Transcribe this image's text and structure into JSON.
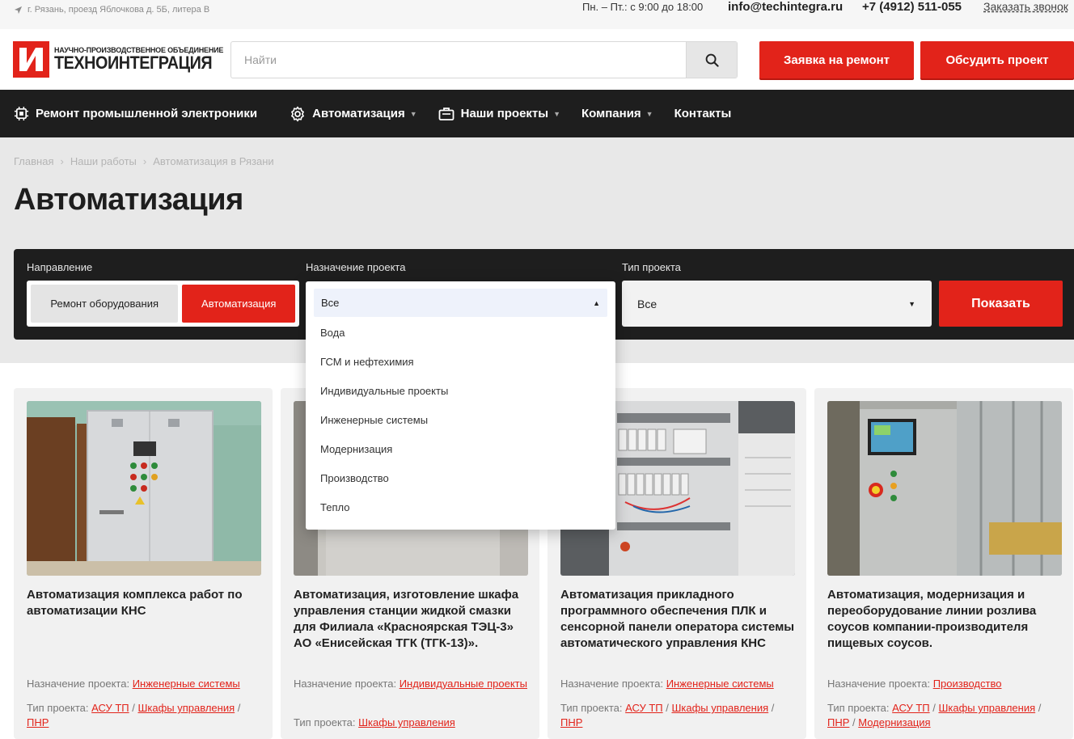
{
  "topbar": {
    "address": "г. Рязань, проезд Яблочкова д. 5Б, литера В",
    "hours": "Пн. – Пт.: с 9:00 до 18:00",
    "email": "info@techintegra.ru",
    "phone": "+7 (4912) 511-055",
    "callback": "Заказать звонок"
  },
  "logo": {
    "subtitle": "НАУЧНО-ПРОИЗВОДСТВЕННОЕ ОБЪЕДИНЕНИЕ",
    "name": "ТЕХНОИНТЕГРАЦИЯ"
  },
  "search": {
    "placeholder": "Найти"
  },
  "header_buttons": {
    "repair": "Заявка на ремонт",
    "discuss": "Обсудить проект"
  },
  "nav": {
    "items": [
      {
        "label": "Ремонт промышленной электроники"
      },
      {
        "label": "Автоматизация"
      },
      {
        "label": "Наши проекты"
      },
      {
        "label": "Компания"
      },
      {
        "label": "Контакты"
      }
    ]
  },
  "breadcrumbs": [
    "Главная",
    "Наши работы",
    "Автоматизация в Рязани"
  ],
  "page_title": "Автоматизация",
  "filters": {
    "direction_label": "Направление",
    "purpose_label": "Назначение проекта",
    "type_label": "Тип проекта",
    "direction_options": [
      "Ремонт оборудования",
      "Автоматизация"
    ],
    "purpose_selected": "Все",
    "purpose_options": [
      "Вода",
      "ГСМ и нефтехимия",
      "Индивидуальные проекты",
      "Инженерные системы",
      "Модернизация",
      "Производство",
      "Тепло"
    ],
    "type_selected": "Все",
    "show_button": "Показать"
  },
  "cards": [
    {
      "title": "Автоматизация комплекса работ по автоматизации КНС",
      "purpose_label": "Назначение проекта:",
      "purpose": "Инженерные системы",
      "type_label": "Тип проекта:",
      "types": [
        "АСУ ТП",
        "Шкафы управления",
        "ПНР"
      ]
    },
    {
      "title": "Автоматизация, изготовление шкафа управления станции жидкой смазки для Филиала «Красноярская ТЭЦ-3» АО «Енисейская ТГК (ТГК-13)».",
      "purpose_label": "Назначение проекта:",
      "purpose": "Индивидуальные проекты",
      "type_label": "Тип проекта:",
      "types": [
        "Шкафы управления"
      ]
    },
    {
      "title": "Автоматизация прикладного программного обеспечения ПЛК и сенсорной панели оператора системы автоматического управления КНС",
      "purpose_label": "Назначение проекта:",
      "purpose": "Инженерные системы",
      "type_label": "Тип проекта:",
      "types": [
        "АСУ ТП",
        "Шкафы управления",
        "ПНР"
      ]
    },
    {
      "title": "Автоматизация, модернизация и переоборудование линии розлива соусов компании-производителя пищевых соусов.",
      "purpose_label": "Назначение проекта:",
      "purpose": "Производство",
      "type_label": "Тип проекта:",
      "types": [
        "АСУ ТП",
        "Шкафы управления",
        "ПНР",
        "Модернизация"
      ]
    }
  ],
  "colors": {
    "accent": "#e2231a",
    "nav_bg": "#1e1e1e",
    "hero_bg": "#e8e8e8"
  }
}
